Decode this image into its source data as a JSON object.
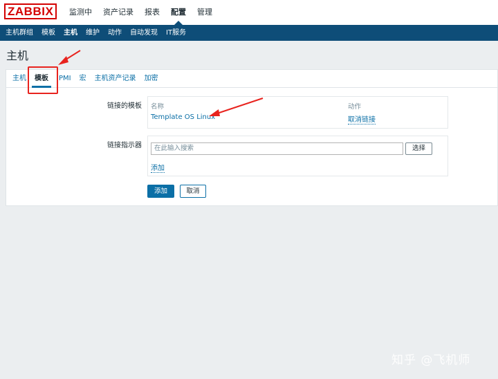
{
  "app": {
    "logo": "ZABBIX"
  },
  "top_nav": [
    "监测中",
    "资产记录",
    "报表",
    "配置",
    "管理"
  ],
  "sub_nav": [
    "主机群组",
    "模板",
    "主机",
    "维护",
    "动作",
    "自动发现",
    "IT服务"
  ],
  "page": {
    "title": "主机"
  },
  "tabs": [
    "主机",
    "模板",
    "IPMI",
    "宏",
    "主机资产记录",
    "加密"
  ],
  "linked_templates": {
    "label": "链接的模板",
    "col_name": "名称",
    "col_action": "动作",
    "template_name": "Template OS Linux",
    "unlink_label": "取消链接"
  },
  "link_new": {
    "label": "链接指示器",
    "search_placeholder": "在此输入搜索",
    "select_label": "选择",
    "add_link_label": "添加"
  },
  "form_buttons": {
    "add": "添加",
    "cancel": "取消"
  },
  "watermark": "知乎 @飞机师",
  "colors": {
    "brand_red": "#d40000",
    "nav_blue": "#0e4d78",
    "link_blue": "#0b6fa6",
    "annotation_red": "#e8231e"
  }
}
